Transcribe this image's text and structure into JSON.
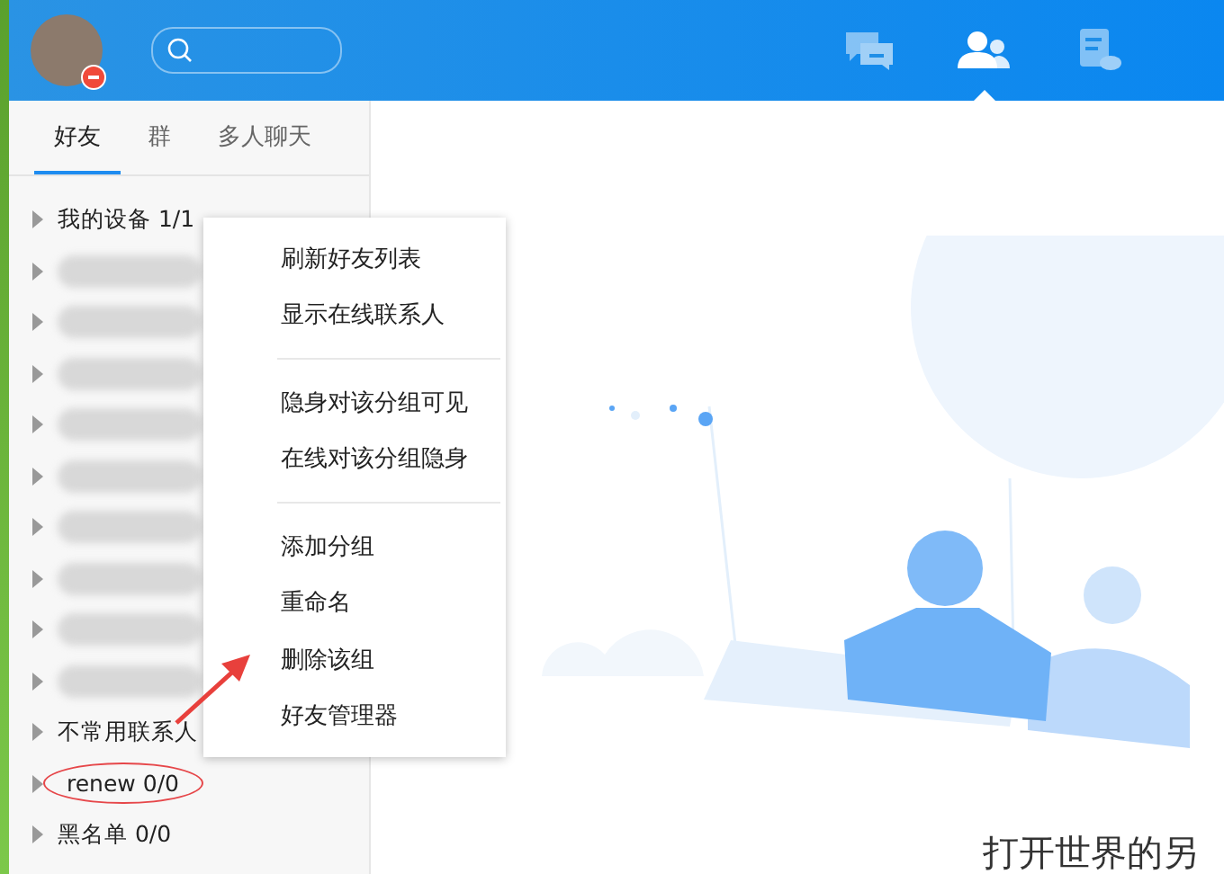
{
  "header": {
    "busy": true,
    "nav": [
      {
        "kind": "message",
        "selected": false
      },
      {
        "kind": "contacts",
        "selected": true
      },
      {
        "kind": "file",
        "selected": false
      }
    ]
  },
  "tabs": [
    {
      "label": "好友",
      "selected": true
    },
    {
      "label": "群",
      "selected": false
    },
    {
      "label": "多人聊天",
      "selected": false
    }
  ],
  "groups": [
    {
      "kind": "group",
      "name": "我的设备",
      "count": "1/1",
      "highlighted": false
    },
    {
      "kind": "blurred"
    },
    {
      "kind": "blurred"
    },
    {
      "kind": "blurred"
    },
    {
      "kind": "blurred"
    },
    {
      "kind": "blurred"
    },
    {
      "kind": "blurred"
    },
    {
      "kind": "blurred"
    },
    {
      "kind": "blurred"
    },
    {
      "kind": "blurred"
    },
    {
      "kind": "group",
      "name": "不常用联系人",
      "highlighted": false
    },
    {
      "kind": "group",
      "name": "renew",
      "count": "0/0",
      "highlighted": true
    },
    {
      "kind": "group",
      "name": "黑名单",
      "count": "0/0",
      "highlighted": false
    }
  ],
  "context_menu": [
    [
      "刷新好友列表",
      "显示在线联系人"
    ],
    [
      "隐身对该分组可见",
      "在线对该分组隐身"
    ],
    [
      "添加分组",
      "重命名",
      "删除该组",
      "好友管理器"
    ]
  ],
  "main": {
    "caption": "打开世界的另"
  }
}
